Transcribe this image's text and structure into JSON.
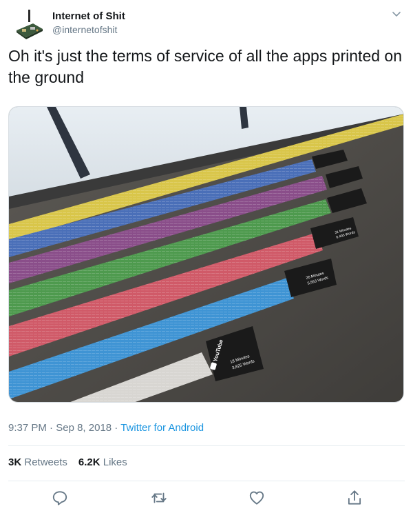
{
  "author": {
    "name": "Internet of Shit",
    "handle": "@internetofshit"
  },
  "tweet": {
    "text": "Oh it's just the terms of service of all the apps printed on the ground"
  },
  "meta": {
    "time": "9:37 PM",
    "sep1": " · ",
    "date": "Sep 8, 2018",
    "sep2": " · ",
    "source": "Twitter for Android"
  },
  "stats": {
    "retweets_count": "3K",
    "retweets_label": " Retweets",
    "likes_count": "6.2K",
    "likes_label": " Likes"
  },
  "photo_labels": {
    "youtube_brand": "YouTube",
    "youtube_minutes": "18 Minutes",
    "youtube_words": "3,825 Words",
    "twitter_minutes": "26 Minutes",
    "twitter_words": "5,553 Words",
    "instagram_minutes": "31 Minutes",
    "instagram_words": "6,493 Words"
  },
  "icons": {
    "chevron": "chevron-down-icon",
    "reply": "reply-icon",
    "retweet": "retweet-icon",
    "like": "heart-icon",
    "share": "share-icon"
  }
}
